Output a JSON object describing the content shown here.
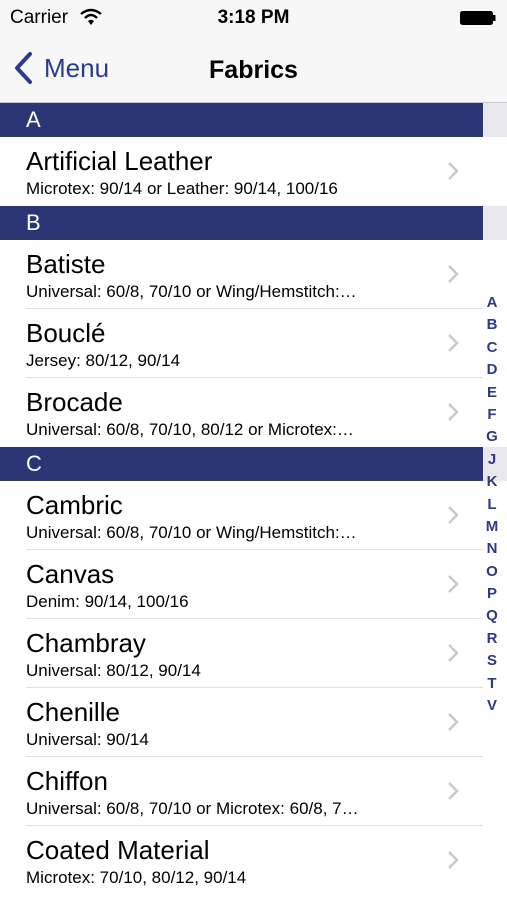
{
  "status": {
    "carrier": "Carrier",
    "time": "3:18 PM"
  },
  "nav": {
    "back_label": "Menu",
    "title": "Fabrics"
  },
  "colors": {
    "accent": "#2b3a8f",
    "section_header": "#2c3575"
  },
  "sections": [
    {
      "letter": "A",
      "rows": [
        {
          "title": "Artificial Leather",
          "subtitle": "Microtex: 90/14 or Leather: 90/14, 100/16"
        }
      ]
    },
    {
      "letter": "B",
      "rows": [
        {
          "title": "Batiste",
          "subtitle": "Universal: 60/8, 70/10 or Wing/Hemstitch:…"
        },
        {
          "title": "Bouclé",
          "subtitle": "Jersey: 80/12, 90/14"
        },
        {
          "title": "Brocade",
          "subtitle": "Universal: 60/8, 70/10, 80/12 or Microtex:…"
        }
      ]
    },
    {
      "letter": "C",
      "rows": [
        {
          "title": "Cambric",
          "subtitle": "Universal: 60/8, 70/10 or Wing/Hemstitch:…"
        },
        {
          "title": "Canvas",
          "subtitle": "Denim: 90/14, 100/16"
        },
        {
          "title": "Chambray",
          "subtitle": "Universal: 80/12, 90/14"
        },
        {
          "title": "Chenille",
          "subtitle": "Universal: 90/14"
        },
        {
          "title": "Chiffon",
          "subtitle": "Universal: 60/8, 70/10 or Microtex: 60/8, 7…"
        },
        {
          "title": "Coated Material",
          "subtitle": "Microtex: 70/10, 80/12, 90/14"
        }
      ]
    }
  ],
  "index_letters": [
    "A",
    "B",
    "C",
    "D",
    "E",
    "F",
    "G",
    "J",
    "K",
    "L",
    "M",
    "N",
    "O",
    "P",
    "Q",
    "R",
    "S",
    "T",
    "V"
  ]
}
